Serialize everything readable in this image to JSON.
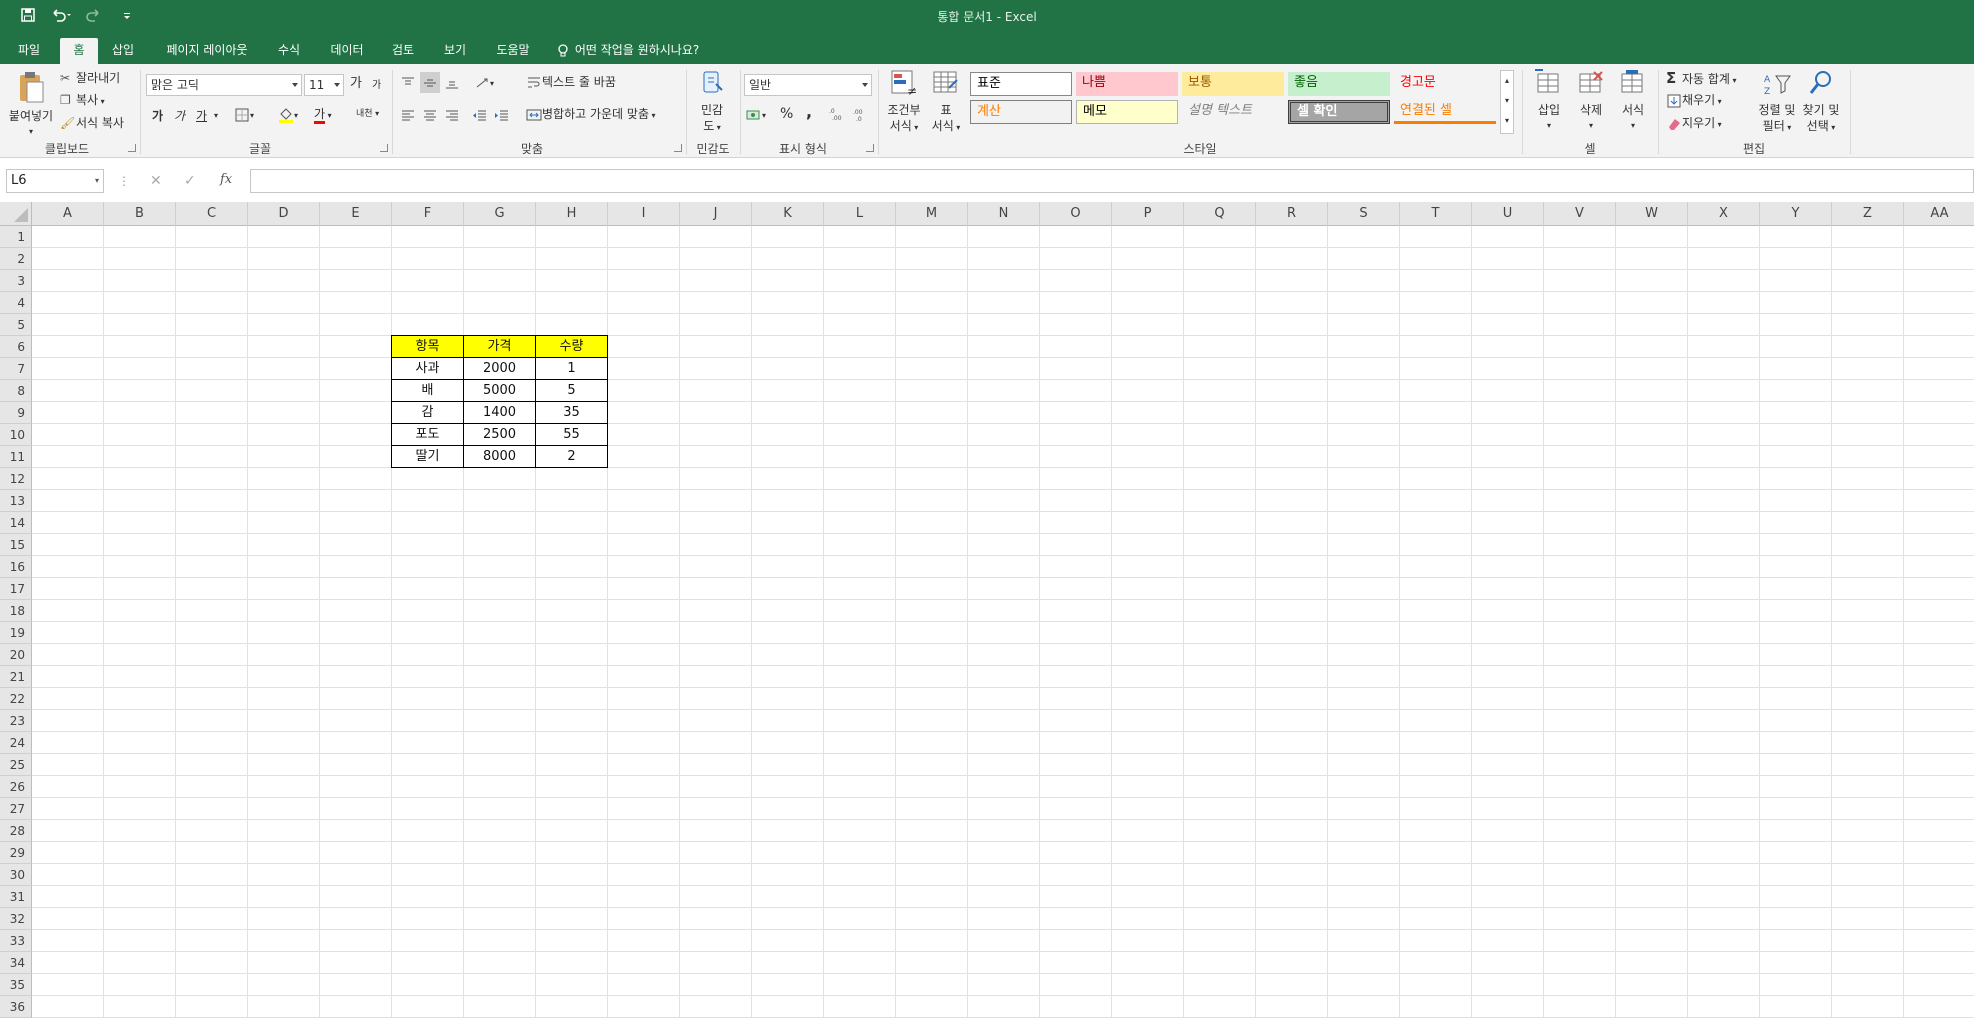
{
  "titlebar": {
    "title": "통합 문서1  -  Excel"
  },
  "tabs": [
    "파일",
    "홈",
    "삽입",
    "페이지 레이아웃",
    "수식",
    "데이터",
    "검토",
    "보기",
    "도움말"
  ],
  "active_tab": "홈",
  "tell_me": "어떤 작업을 원하시나요?",
  "ribbon": {
    "clipboard": {
      "paste": "붙여넣기",
      "cut": "잘라내기",
      "copy": "복사",
      "format_painter": "서식 복사",
      "label": "클립보드"
    },
    "font": {
      "name": "맑은 고딕",
      "size": "11",
      "grow": "가",
      "shrink": "가",
      "bold": "가",
      "italic": "가",
      "underline": "가",
      "color_letter": "가",
      "phonetic": "내천",
      "label": "글꼴"
    },
    "alignment": {
      "wrap_text": "텍스트 줄 바꿈",
      "merge_center": "병합하고 가운데 맞춤",
      "label": "맞춤"
    },
    "sensitivity": {
      "button_line1": "민감",
      "button_line2": "도",
      "label": "민감도"
    },
    "number": {
      "format": "일반",
      "percent": "%",
      "comma": ",",
      "label": "표시 형식"
    },
    "styles": {
      "conditional": [
        "조건부",
        "서식"
      ],
      "table": [
        "표",
        "서식"
      ],
      "cells": [
        {
          "text": "표준",
          "bg": "#ffffff",
          "fg": "#000000"
        },
        {
          "text": "나쁨",
          "bg": "#ffc7ce",
          "fg": "#9c0006"
        },
        {
          "text": "보통",
          "bg": "#ffeb9c",
          "fg": "#9c5700"
        },
        {
          "text": "좋음",
          "bg": "#c6efce",
          "fg": "#006100"
        },
        {
          "text": "경고문",
          "bg": "#f3f3f3",
          "fg": "#ff0000"
        },
        {
          "text": "계산",
          "bg": "#f2f2f2",
          "fg": "#fa7d00"
        },
        {
          "text": "메모",
          "bg": "#ffffcc",
          "fg": "#000000"
        },
        {
          "text": "설명 텍스트",
          "bg": "#f3f3f3",
          "fg": "#7f7f7f"
        },
        {
          "text": "셀 확인",
          "bg": "#a5a5a5",
          "fg": "#ffffff"
        },
        {
          "text": "연결된 셀",
          "bg": "#f3f3f3",
          "fg": "#fa7d00"
        }
      ],
      "label": "스타일"
    },
    "cells": {
      "insert": "삽입",
      "delete": "삭제",
      "format": "서식",
      "label": "셀"
    },
    "editing": {
      "autosum": "자동 합계",
      "fill": "채우기",
      "clear": "지우기",
      "sort1": "정렬 및",
      "sort2": "필터",
      "find1": "찾기 및",
      "find2": "선택",
      "label": "편집"
    }
  },
  "formula_bar": {
    "name_box": "L6",
    "formula": ""
  },
  "columns": [
    "A",
    "B",
    "C",
    "D",
    "E",
    "F",
    "G",
    "H",
    "I",
    "J",
    "K",
    "L",
    "M",
    "N",
    "O",
    "P",
    "Q",
    "R",
    "S",
    "T",
    "U",
    "V",
    "W",
    "X",
    "Y",
    "Z",
    "AA"
  ],
  "rows": [
    "1",
    "2",
    "3",
    "4",
    "5",
    "6",
    "7",
    "8",
    "9",
    "10",
    "11",
    "12",
    "13",
    "14",
    "15",
    "16",
    "17",
    "18",
    "19",
    "20",
    "21",
    "22",
    "23",
    "24",
    "25",
    "26",
    "27",
    "28",
    "29",
    "30",
    "31",
    "32",
    "33",
    "34",
    "35",
    "36"
  ],
  "table": {
    "header": [
      "항목",
      "가격",
      "수량"
    ],
    "rows": [
      [
        "사과",
        "2000",
        "1"
      ],
      [
        "배",
        "5000",
        "5"
      ],
      [
        "감",
        "1400",
        "35"
      ],
      [
        "포도",
        "2500",
        "55"
      ],
      [
        "딸기",
        "8000",
        "2"
      ]
    ],
    "header_color": "#ffff00"
  },
  "colors": {
    "accent": "#217346"
  }
}
